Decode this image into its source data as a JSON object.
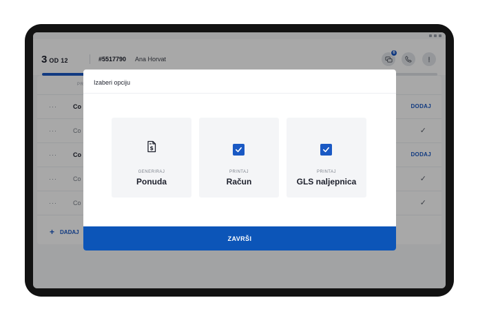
{
  "header": {
    "counter_current": "3",
    "counter_of": "OD 12",
    "order_number": "#5517790",
    "customer_name": "Ana Horvat",
    "messages_badge": "6",
    "progress_fraction": 0.25
  },
  "list": {
    "column_header": "PRO",
    "rows": [
      {
        "menu": "···",
        "name": "Co",
        "action": "DODAJ",
        "state": "pending"
      },
      {
        "menu": "···",
        "name": "Co",
        "action": "✓",
        "state": "done"
      },
      {
        "menu": "···",
        "name": "Co",
        "action": "DODAJ",
        "state": "pending"
      },
      {
        "menu": "···",
        "name": "Co",
        "action": "✓",
        "state": "done"
      },
      {
        "menu": "···",
        "name": "Co",
        "action": "✓",
        "state": "done"
      }
    ],
    "add_label": "DADAJ",
    "add_icon": "+"
  },
  "modal": {
    "title": "Izaberi opciju",
    "options": [
      {
        "caption": "GENERIRAJ",
        "title": "Ponuda",
        "icon": "invoice-dollar-icon",
        "checked": false
      },
      {
        "caption": "PRINTAJ",
        "title": "Račun",
        "icon": "checkbox-checked-icon",
        "checked": true
      },
      {
        "caption": "PRINTAJ",
        "title": "GLS naljepnica",
        "icon": "checkbox-checked-icon",
        "checked": true
      }
    ],
    "finish_label": "ZAVRŠI"
  },
  "colors": {
    "accent": "#1a59c4",
    "finish_button": "#0c55b8",
    "frame": "#121212"
  }
}
